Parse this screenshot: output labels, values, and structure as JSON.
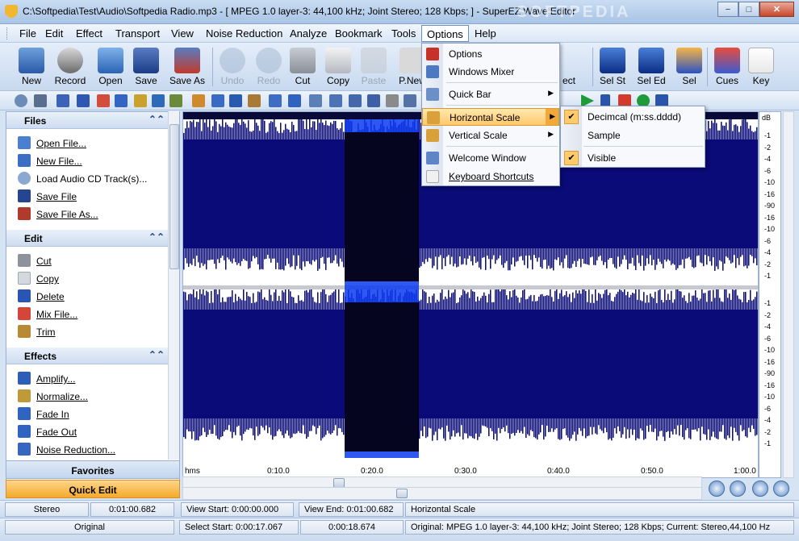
{
  "window": {
    "title": "C:\\Softpedia\\Test\\Audio\\Softpedia Radio.mp3 - [ MPEG 1.0 layer-3: 44,100 kHz; Joint Stereo; 128 Kbps; ] - SuperEZ Wave Editor",
    "watermark": "SOFTPEDIA",
    "minimize": "−",
    "maximize": "□",
    "close": "✕"
  },
  "menu": {
    "file": "File",
    "edit": "Edit",
    "effect": "Effect",
    "transport": "Transport",
    "view": "View",
    "noise": "Noise Reduction",
    "analyze": "Analyze",
    "bookmark": "Bookmark",
    "tools": "Tools",
    "options": "Options",
    "help": "Help"
  },
  "toolbar": {
    "new": "New",
    "record": "Record",
    "open": "Open",
    "save": "Save",
    "save_as": "Save As",
    "undo": "Undo",
    "redo": "Redo",
    "cut": "Cut",
    "copy": "Copy",
    "paste": "Paste",
    "pnew": "P.New",
    "effect": "ect",
    "sel_st": "Sel St",
    "sel_ed": "Sel Ed",
    "sel": "Sel",
    "cues": "Cues",
    "key": "Key"
  },
  "options_menu": {
    "options": "Options",
    "windows_mixer": "Windows Mixer",
    "quick_bar": "Quick Bar",
    "horizontal_scale": "Horizontal Scale",
    "vertical_scale": "Vertical Scale",
    "welcome_window": "Welcome Window",
    "keyboard_shortcuts": "Keyboard Shortcuts",
    "arrow": "▶"
  },
  "horizontal_submenu": {
    "decimal": "Decimcal (m:ss.dddd)",
    "sample": "Sample",
    "visible": "Visible",
    "check": "✔"
  },
  "left_panel": {
    "files_header": "Files",
    "files": [
      "Open File...",
      "New File...",
      "Load Audio CD Track(s)...",
      "Save File",
      "Save File As..."
    ],
    "edit_header": "Edit",
    "edit": [
      "Cut",
      "Copy",
      "Delete",
      "Mix File...",
      "Trim"
    ],
    "effects_header": "Effects",
    "effects": [
      "Amplify...",
      "Normalize...",
      "Fade In",
      "Fade Out",
      "Noise Reduction..."
    ],
    "collapse": "⌃⌃",
    "favorites": "Favorites",
    "quick_edit": "Quick Edit"
  },
  "timeline": {
    "unit": "hms",
    "ticks": [
      "0:10.0",
      "0:20.0",
      "0:30.0",
      "0:40.0",
      "0:50.0",
      "1:00.0"
    ]
  },
  "db_scale": {
    "header": "dB",
    "ch1": [
      "-1",
      "-2",
      "-4",
      "-6",
      "-10",
      "-16",
      "-90",
      "-16",
      "-10",
      "-6",
      "-4",
      "-2",
      "-1"
    ],
    "ch2": [
      "-1",
      "-2",
      "-4",
      "-6",
      "-10",
      "-16",
      "-90",
      "-16",
      "-10",
      "-6",
      "-4",
      "-2",
      "-1"
    ]
  },
  "status1": {
    "channels": "Stereo",
    "length": "0:01:00.682",
    "view_start": "View Start: 0:00:00.000",
    "view_end": "View End: 0:01:00.682",
    "hint": "Horizontal Scale"
  },
  "status2": {
    "mode": "Original",
    "select_start": "Select Start: 0:00:17.067",
    "select_len": "0:00:18.674",
    "info": "Original: MPEG 1.0 layer-3: 44,100 kHz; Joint Stereo; 128 Kbps;   Current: Stereo,44,100 Hz"
  }
}
